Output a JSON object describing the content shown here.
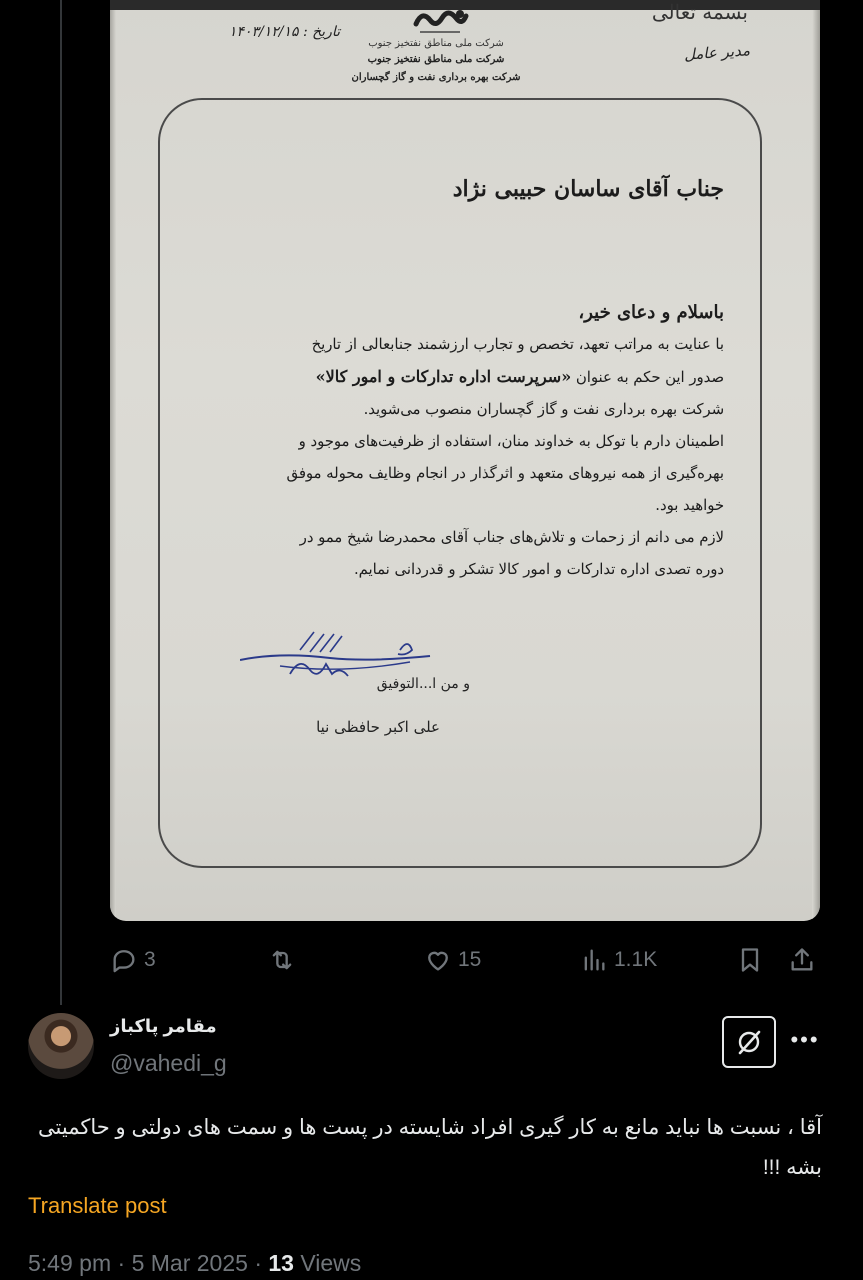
{
  "letter": {
    "top_right_scrap": "بسمه تعالی",
    "managing_director_label": "مدیر عامل",
    "date_label": "تاریخ : ۱۴۰۳/۱۲/۱۵",
    "company_lines": [
      "شرکت ملی مناطق نفتخیز جنوب",
      "شرکت بهره برداری نفت و گاز گچساران"
    ],
    "addressee": "جناب آقای ساسان حبیبی نژاد",
    "greeting": "باسلام و دعای خیر،",
    "paragraph_1_a": "با عنایت به مراتب تعهد، تخصص و تجارب ارزشمند جنابعالی از تاریخ",
    "paragraph_1_b_pre": "صدور این حکم به عنوان ",
    "paragraph_1_b_bold": "«سرپرست اداره تدارکات و امور کالا»",
    "paragraph_1_c": "شرکت بهره برداری نفت و گاز گچساران منصوب می‌شوید.",
    "paragraph_2_a": "اطمینان دارم با توکل به خداوند منان، استفاده از ظرفیت‌های موجود و",
    "paragraph_2_b": "بهره‌گیری از همه نیروهای متعهد و اثرگذار در انجام وظایف محوله موفق",
    "paragraph_2_c": "خواهید بود.",
    "paragraph_3_a": "لازم می دانم از زحمات و تلاش‌های جناب آقای محمدرضا شیخ ممو در",
    "paragraph_3_b": "دوره تصدی اداره تدارکات و امور کالا تشکر و قدردانی نمایم.",
    "closing": "و من ا...التوفیق",
    "signer": "علی اکبر حافظی نیا"
  },
  "actions": {
    "replies": "3",
    "likes": "15",
    "views": "1.1K"
  },
  "reply": {
    "display_name": "مقامر پاکباز",
    "handle": "@vahedi_g",
    "text": "آقا ، نسبت ها نباید مانع به کار گیری افراد شایسته در پست ها و سمت های دولتی و حاکمیتی بشه !!!",
    "translate_label": "Translate post",
    "time": "5:49 pm",
    "date": "5 Mar 2025",
    "views_count": "13",
    "views_label": "Views"
  },
  "colors": {
    "background": "#000000",
    "text": "#e7e9ea",
    "muted": "#71767b",
    "translate": "#f5a623"
  },
  "icons": [
    "reply-icon",
    "repost-icon",
    "like-icon",
    "views-icon",
    "bookmark-icon",
    "share-icon",
    "grok-icon",
    "more-icon"
  ]
}
